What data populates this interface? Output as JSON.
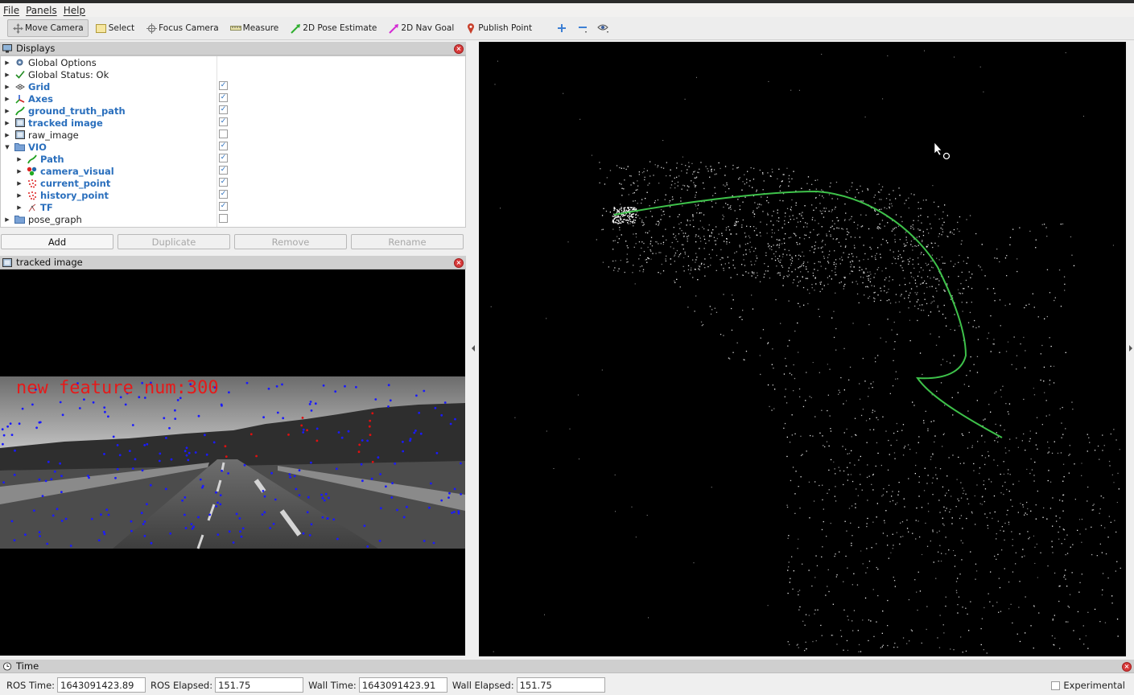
{
  "menu": [
    "File",
    "Panels",
    "Help"
  ],
  "toolbar": {
    "tools": [
      {
        "label": "Move Camera",
        "icon": "move-camera-icon",
        "active": true
      },
      {
        "label": "Select",
        "icon": "select-icon",
        "active": false
      },
      {
        "label": "Focus Camera",
        "icon": "focus-camera-icon",
        "active": false
      },
      {
        "label": "Measure",
        "icon": "ruler-icon",
        "active": false
      },
      {
        "label": "2D Pose Estimate",
        "icon": "green-arrow-icon",
        "active": false
      },
      {
        "label": "2D Nav Goal",
        "icon": "magenta-arrow-icon",
        "active": false
      },
      {
        "label": "Publish Point",
        "icon": "map-pin-icon",
        "active": false
      }
    ],
    "extra_icons": [
      "plus-icon",
      "minus-icon",
      "eye-icon"
    ]
  },
  "displays": {
    "title": "Displays",
    "items": [
      {
        "label": "Global Options",
        "icon": "gear-icon",
        "blue": false,
        "checked": null,
        "depth": 0,
        "expanded": false
      },
      {
        "label": "Global Status: Ok",
        "icon": "check-icon",
        "blue": false,
        "checked": null,
        "depth": 0,
        "expanded": false
      },
      {
        "label": "Grid",
        "icon": "grid-icon",
        "blue": true,
        "checked": true,
        "depth": 0,
        "expanded": false
      },
      {
        "label": "Axes",
        "icon": "axes-icon",
        "blue": true,
        "checked": true,
        "depth": 0,
        "expanded": false
      },
      {
        "label": "ground_truth_path",
        "icon": "path-icon",
        "blue": true,
        "checked": true,
        "depth": 0,
        "expanded": false
      },
      {
        "label": "tracked image",
        "icon": "image-icon",
        "blue": true,
        "checked": true,
        "depth": 0,
        "expanded": false
      },
      {
        "label": "raw_image",
        "icon": "image-icon",
        "blue": false,
        "checked": false,
        "depth": 0,
        "expanded": false
      },
      {
        "label": "VIO",
        "icon": "folder-icon",
        "blue": true,
        "checked": true,
        "depth": 0,
        "expanded": true
      },
      {
        "label": "Path",
        "icon": "path-icon",
        "blue": true,
        "checked": true,
        "depth": 1,
        "expanded": false
      },
      {
        "label": "camera_visual",
        "icon": "marker-icon",
        "blue": true,
        "checked": true,
        "depth": 1,
        "expanded": false
      },
      {
        "label": "current_point",
        "icon": "pointcloud-icon",
        "blue": true,
        "checked": true,
        "depth": 1,
        "expanded": false
      },
      {
        "label": "history_point",
        "icon": "pointcloud-icon",
        "blue": true,
        "checked": true,
        "depth": 1,
        "expanded": false
      },
      {
        "label": "TF",
        "icon": "tf-icon",
        "blue": true,
        "checked": true,
        "depth": 1,
        "expanded": false
      },
      {
        "label": "pose_graph",
        "icon": "folder-icon",
        "blue": false,
        "checked": false,
        "depth": 0,
        "expanded": false
      }
    ],
    "buttons": [
      {
        "label": "Add",
        "enabled": true
      },
      {
        "label": "Duplicate",
        "enabled": false
      },
      {
        "label": "Remove",
        "enabled": false
      },
      {
        "label": "Rename",
        "enabled": false
      }
    ]
  },
  "tracked_image": {
    "title": "tracked image",
    "overlay_text": "new feature num:300"
  },
  "time": {
    "title": "Time",
    "ros_time_label": "ROS Time:",
    "ros_time": "1643091423.89",
    "ros_elapsed_label": "ROS Elapsed:",
    "ros_elapsed": "151.75",
    "wall_time_label": "Wall Time:",
    "wall_time": "1643091423.91",
    "wall_elapsed_label": "Wall Elapsed:",
    "wall_elapsed": "151.75",
    "experimental_label": "Experimental",
    "experimental_checked": false
  },
  "colors": {
    "link_blue": "#2a6fbd",
    "path_green": "#3ec24a",
    "feature_blue": "#1a1aff",
    "feature_red": "#e01010",
    "overlay_red": "#e51a1a"
  }
}
